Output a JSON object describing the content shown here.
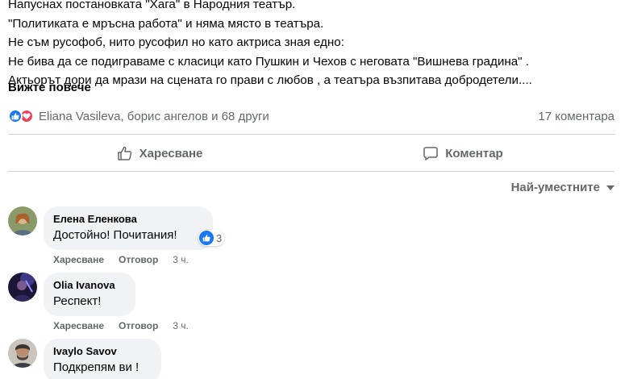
{
  "post": {
    "lines": [
      "Напуснах постановката \"Хага\" в Народния театър.",
      "\"Политиката е мръсна работа\" и няма място в театъра.",
      "Не съм русофоб, нито русофил но като актриса зная едно:",
      "Не бива да се подиграваме с класици като Пушкин и Чехов с неговата \"Вишнева градина\" .",
      "Актьорът дори да мрази на сцената го прави с любов , а театъра възпитава добродетели...."
    ],
    "see_more": "Вижте повече"
  },
  "reactions": {
    "names": "Eliana Vasileva, борис ангелов и 68 други",
    "comments_count": "17 коментара"
  },
  "actions": {
    "like": "Харесване",
    "comment": "Коментар"
  },
  "sort": {
    "label": "Най-уместните"
  },
  "comments": [
    {
      "author": "Елена Еленкова",
      "text": "Достойно! Почитания!",
      "reaction_count": "3",
      "like": "Харесване",
      "reply": "Отговор",
      "time": "3 ч."
    },
    {
      "author": "Olia Ivanova",
      "text": "Респект!",
      "like": "Харесване",
      "reply": "Отговор",
      "time": "3 ч."
    },
    {
      "author": "Ivaylo Savov",
      "text": "Подкрепям ви !"
    }
  ],
  "colors": {
    "accent": "#1877f2",
    "love": "#f33e58",
    "secondary_text": "#65676b",
    "bubble": "#f0f2f5"
  }
}
